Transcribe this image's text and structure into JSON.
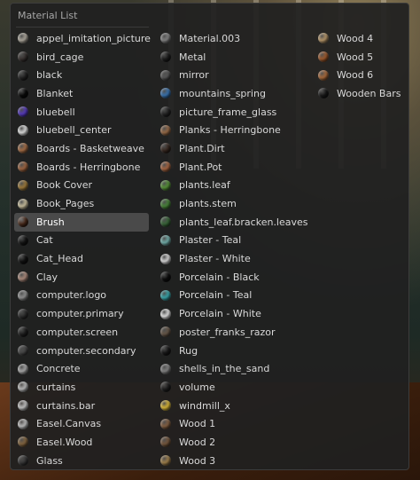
{
  "panel": {
    "title": "Material List"
  },
  "columns": [
    [
      {
        "label": "appel_imitation_picture",
        "icon": "material-sphere-icon",
        "color": "#b8b2a6"
      },
      {
        "label": "bird_cage",
        "icon": "material-sphere-icon",
        "color": "#3a3432"
      },
      {
        "label": "black",
        "icon": "material-sphere-icon",
        "color": "#262626"
      },
      {
        "label": "Blanket",
        "icon": "material-sphere-icon",
        "color": "#0a0a0a"
      },
      {
        "label": "bluebell",
        "icon": "material-sphere-icon",
        "color": "#5a3cc8"
      },
      {
        "label": "bluebell_center",
        "icon": "material-sphere-icon",
        "color": "#ececec"
      },
      {
        "label": "Boards - Basketweave",
        "icon": "material-sphere-icon",
        "color": "#b0744a"
      },
      {
        "label": "Boards - Herringbone",
        "icon": "material-sphere-icon",
        "color": "#a86a44"
      },
      {
        "label": "Book Cover",
        "icon": "material-sphere-icon",
        "color": "#a8823e"
      },
      {
        "label": "Book_Pages",
        "icon": "material-sphere-icon",
        "color": "#d6cba8"
      },
      {
        "label": "Brush",
        "icon": "material-sphere-icon",
        "color": "#4a2a1a",
        "selected": true
      },
      {
        "label": "Cat",
        "icon": "material-sphere-icon",
        "color": "#161616"
      },
      {
        "label": "Cat_Head",
        "icon": "material-sphere-icon",
        "color": "#121212"
      },
      {
        "label": "Clay",
        "icon": "material-sphere-icon",
        "color": "#b89484"
      },
      {
        "label": "computer.logo",
        "icon": "material-sphere-icon",
        "color": "#9a9a9a"
      },
      {
        "label": "computer.primary",
        "icon": "material-sphere-icon",
        "color": "#303030"
      },
      {
        "label": "computer.screen",
        "icon": "material-sphere-icon",
        "color": "#202020"
      },
      {
        "label": "computer.secondary",
        "icon": "material-sphere-icon",
        "color": "#4a4a4a"
      },
      {
        "label": "Concrete",
        "icon": "material-sphere-icon",
        "color": "#b4b4b4"
      },
      {
        "label": "curtains",
        "icon": "material-sphere-icon",
        "color": "#c6c6c6"
      },
      {
        "label": "curtains.bar",
        "icon": "material-sphere-icon",
        "color": "#d0d0d0"
      },
      {
        "label": "Easel.Canvas",
        "icon": "material-sphere-icon",
        "color": "#c8c8c8"
      },
      {
        "label": "Easel.Wood",
        "icon": "material-sphere-icon",
        "color": "#8a6a42"
      },
      {
        "label": "Glass",
        "icon": "material-sphere-icon",
        "color": "#3a3a3a"
      }
    ],
    [
      {
        "label": "Material.003",
        "icon": "material-sphere-icon",
        "color": "#8a8a8a"
      },
      {
        "label": "Metal",
        "icon": "material-sphere-icon",
        "color": "#1e1e1e"
      },
      {
        "label": "mirror",
        "icon": "material-sphere-icon",
        "color": "#5a5a5a"
      },
      {
        "label": "mountains_spring",
        "icon": "material-sphere-icon",
        "color": "#3a78b8"
      },
      {
        "label": "picture_frame_glass",
        "icon": "material-sphere-icon",
        "color": "#262626"
      },
      {
        "label": "Planks - Herringbone",
        "icon": "material-sphere-icon",
        "color": "#a0704a"
      },
      {
        "label": "Plant.Dirt",
        "icon": "material-sphere-icon",
        "color": "#3a2a22"
      },
      {
        "label": "Plant.Pot",
        "icon": "material-sphere-icon",
        "color": "#b06a44"
      },
      {
        "label": "plants.leaf",
        "icon": "material-sphere-icon",
        "color": "#5a9a3a"
      },
      {
        "label": "plants.stem",
        "icon": "material-sphere-icon",
        "color": "#4a8a3a"
      },
      {
        "label": "plants_leaf.bracken.leaves",
        "icon": "material-sphere-icon",
        "color": "#3a6a3a"
      },
      {
        "label": "Plaster - Teal",
        "icon": "material-sphere-icon",
        "color": "#78b8b4"
      },
      {
        "label": "Plaster - White",
        "icon": "material-sphere-icon",
        "color": "#e4e4e4"
      },
      {
        "label": "Porcelain - Black",
        "icon": "material-sphere-icon",
        "color": "#0e0e0e"
      },
      {
        "label": "Porcelain - Teal",
        "icon": "material-sphere-icon",
        "color": "#3ab0b4"
      },
      {
        "label": "Porcelain - White",
        "icon": "material-sphere-icon",
        "color": "#f0f0f0"
      },
      {
        "label": "poster_franks_razor",
        "icon": "material-sphere-icon",
        "color": "#6a5a4a"
      },
      {
        "label": "Rug",
        "icon": "material-sphere-icon",
        "color": "#1a1a1a"
      },
      {
        "label": "shells_in_the_sand",
        "icon": "material-sphere-icon",
        "color": "#8a8a8a"
      },
      {
        "label": "volume",
        "icon": "material-sphere-icon",
        "color": "#202020"
      },
      {
        "label": "windmill_x",
        "icon": "material-sphere-icon",
        "color": "#e6c23a"
      },
      {
        "label": "Wood 1",
        "icon": "material-sphere-icon",
        "color": "#8a6444"
      },
      {
        "label": "Wood 2",
        "icon": "material-sphere-icon",
        "color": "#7a5a3e"
      },
      {
        "label": "Wood 3",
        "icon": "material-sphere-icon",
        "color": "#a8864e"
      }
    ],
    [
      {
        "label": "Wood 4",
        "icon": "material-sphere-icon",
        "color": "#c2a070"
      },
      {
        "label": "Wood 5",
        "icon": "material-sphere-icon",
        "color": "#a85e2e"
      },
      {
        "label": "Wood 6",
        "icon": "material-sphere-icon",
        "color": "#b4703e"
      },
      {
        "label": "Wooden Bars",
        "icon": "material-sphere-icon",
        "color": "#1a1a1a"
      }
    ]
  ]
}
